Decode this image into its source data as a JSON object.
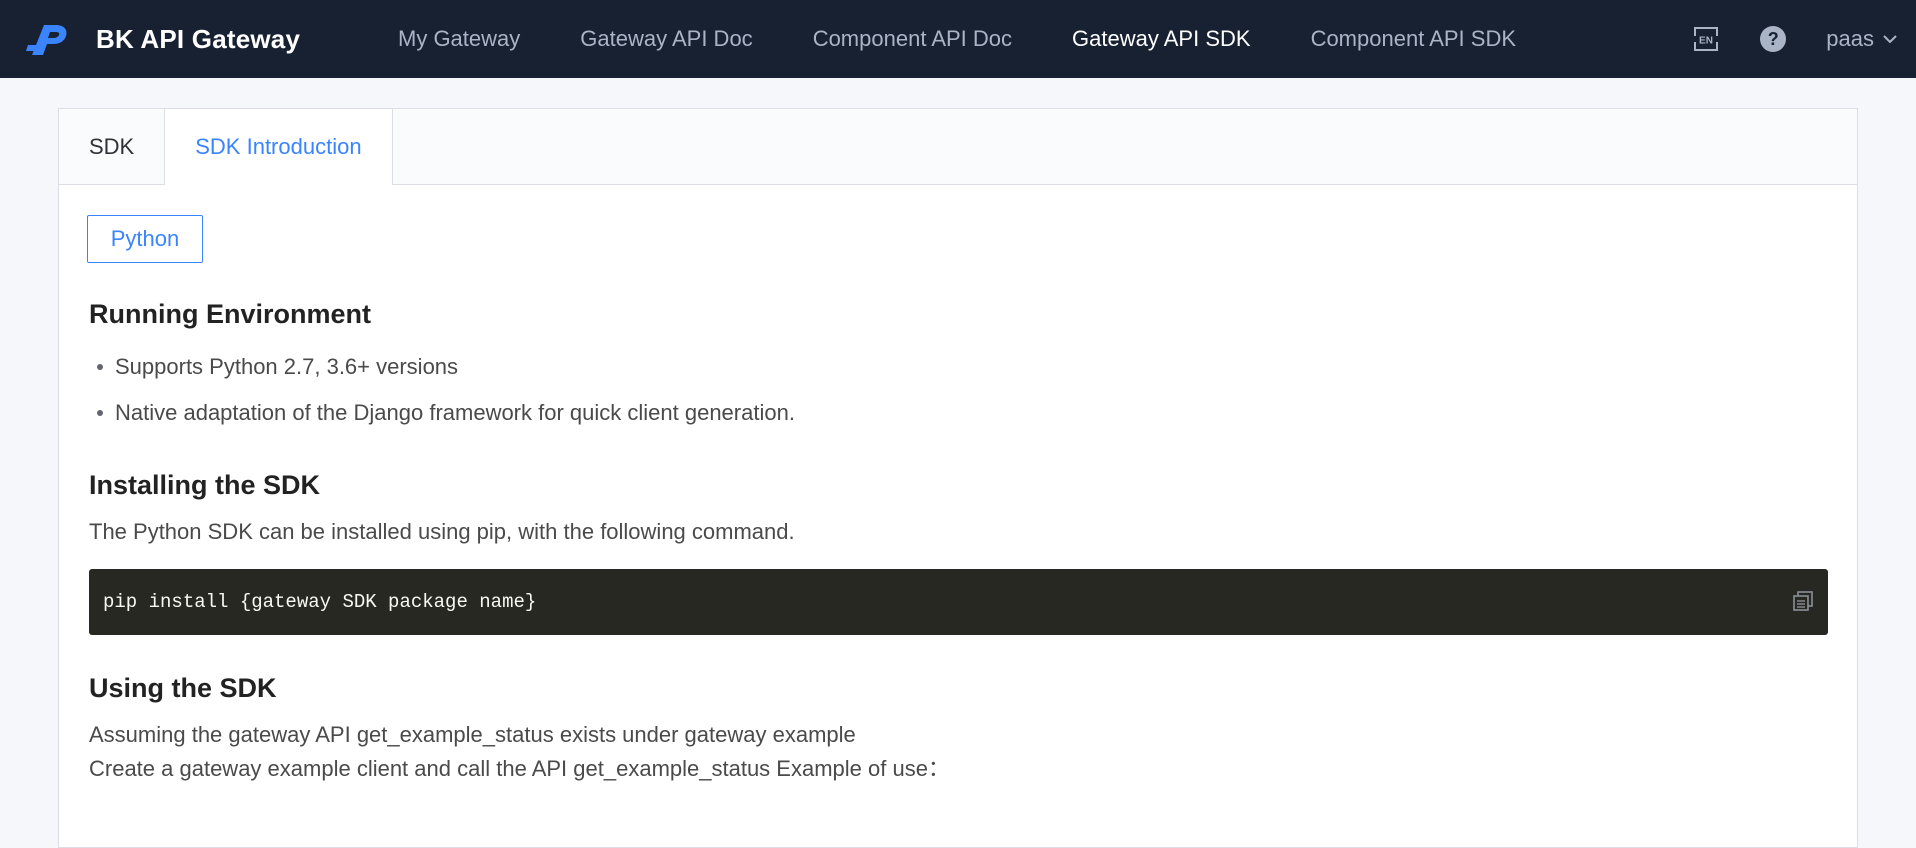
{
  "header": {
    "brand": "BK API Gateway",
    "nav": [
      {
        "label": "My Gateway",
        "active": false
      },
      {
        "label": "Gateway API Doc",
        "active": false
      },
      {
        "label": "Component API Doc",
        "active": false
      },
      {
        "label": "Gateway API SDK",
        "active": true
      },
      {
        "label": "Component API SDK",
        "active": false
      }
    ],
    "icons": {
      "lang": "language-en-icon",
      "help": "help-icon"
    },
    "help_glyph": "?",
    "user": "paas"
  },
  "tabs": [
    {
      "label": "SDK",
      "active": false
    },
    {
      "label": "SDK Introduction",
      "active": true
    }
  ],
  "content": {
    "language_button": "Python",
    "env_title": "Running Environment",
    "env_items": [
      "Supports Python 2.7, 3.6+ versions",
      "Native adaptation of the Django framework for quick client generation."
    ],
    "install_title": "Installing the SDK",
    "install_text": "The Python SDK can be installed using pip, with the following command.",
    "install_code": "pip install {gateway SDK package name}",
    "use_title": "Using the SDK",
    "use_line1": "Assuming the gateway API get_example_status exists under gateway example",
    "use_line2": "Create a gateway example client and call the API get_example_status Example of use："
  },
  "colors": {
    "topbar": "#182132",
    "accent": "#3a84ff",
    "code_bg": "#272822"
  }
}
